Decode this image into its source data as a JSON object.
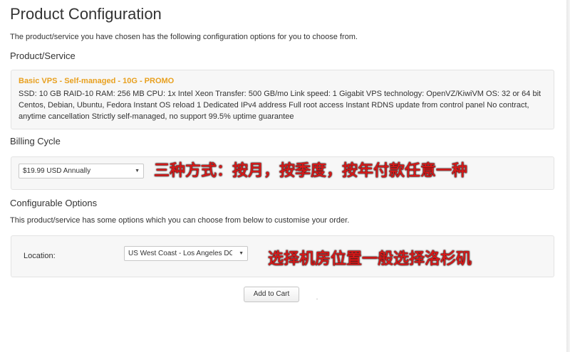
{
  "page_title": "Product Configuration",
  "intro_text": "The product/service you have chosen has the following configuration options for you to choose from.",
  "product_section": {
    "title": "Product/Service",
    "product_name": "Basic VPS - Self-managed - 10G - PROMO",
    "description": "SSD: 10 GB RAID-10 RAM: 256 MB CPU: 1x Intel Xeon Transfer: 500 GB/mo Link speed: 1 Gigabit VPS technology: OpenVZ/KiwiVM OS: 32 or 64 bit Centos, Debian, Ubuntu, Fedora Instant OS reload 1 Dedicated IPv4 address Full root access Instant RDNS update from control panel No contract, anytime cancellation Strictly self-managed, no support 99.5% uptime guarantee"
  },
  "billing_section": {
    "title": "Billing Cycle",
    "selected": "$19.99 USD Annually",
    "annotation": "三种方式：按月，按季度，按年付款任意一种"
  },
  "options_section": {
    "title": "Configurable Options",
    "description": "This product/service has some options which you can choose from below to customise your order.",
    "location_label": "Location:",
    "location_selected": "US West Coast - Los Angeles DC",
    "annotation": "选择机房位置一般选择洛杉矶"
  },
  "add_to_cart_label": "Add to Cart",
  "icons": {
    "dropdown": "▼"
  },
  "colors": {
    "product_name": "#e8a01f",
    "annotation": "#d31a1a"
  }
}
